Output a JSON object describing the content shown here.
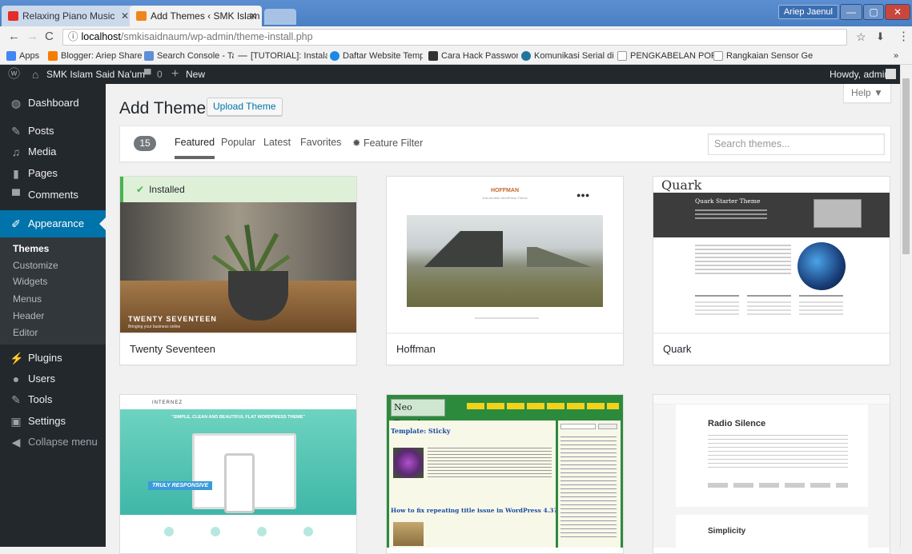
{
  "browser": {
    "tabs": [
      {
        "title": "Relaxing Piano Music",
        "favicon_color": "#e52d27"
      },
      {
        "title": "Add Themes ‹ SMK Islam",
        "favicon_color": "#f0851b"
      }
    ],
    "user_chip": "Ariep Jaenul",
    "url_host": "localhost",
    "url_path": "/smkisaidnaum/wp-admin/theme-install.php",
    "bookmarks": [
      {
        "label": "Apps",
        "icon_color": "#4285f4"
      },
      {
        "label": "Blogger: Ariep Share",
        "icon_color": "#f57d00"
      },
      {
        "label": "Search Console - Tau",
        "icon_color": "#5f8fd6"
      },
      {
        "label": "[TUTORIAL]: Instalasi",
        "icon_color": "#9e9e9e"
      },
      {
        "label": "Daftar Website Temp",
        "icon_color": "#1e88e5"
      },
      {
        "label": "Cara Hack Password",
        "icon_color": "#333333"
      },
      {
        "label": "Komunikasi Serial di",
        "icon_color": "#21759b"
      },
      {
        "label": "PENGKABELAN PORT",
        "icon_color": "#ffffff"
      },
      {
        "label": "Rangkaian Sensor Ge",
        "icon_color": "#ffffff"
      }
    ],
    "bookmarks_overflow": "»"
  },
  "adminbar": {
    "site_name": "SMK Islam Said Na'um",
    "comments_count": "0",
    "new_label": "New",
    "howdy": "Howdy, admin"
  },
  "sidebar": {
    "items": [
      {
        "label": "Dashboard",
        "icon": "dashboard-icon"
      },
      {
        "label": "Posts",
        "icon": "pin-icon"
      },
      {
        "label": "Media",
        "icon": "media-icon"
      },
      {
        "label": "Pages",
        "icon": "page-icon"
      },
      {
        "label": "Comments",
        "icon": "comment-icon"
      },
      {
        "label": "Appearance",
        "icon": "brush-icon"
      },
      {
        "label": "Plugins",
        "icon": "plugin-icon"
      },
      {
        "label": "Users",
        "icon": "user-icon"
      },
      {
        "label": "Tools",
        "icon": "wrench-icon"
      },
      {
        "label": "Settings",
        "icon": "settings-icon"
      },
      {
        "label": "Collapse menu",
        "icon": "collapse-icon"
      }
    ],
    "appearance_sub": [
      "Themes",
      "Customize",
      "Widgets",
      "Menus",
      "Header",
      "Editor"
    ]
  },
  "main": {
    "help_label": "Help ▼",
    "title": "Add Themes",
    "upload_label": "Upload Theme",
    "theme_count": "15",
    "filters": [
      "Featured",
      "Popular",
      "Latest",
      "Favorites"
    ],
    "feature_filter": "Feature Filter",
    "search_placeholder": "Search themes...",
    "installed_label": "Installed",
    "themes": [
      {
        "name": "Twenty Seventeen",
        "shot_text": "TWENTY SEVENTEEN",
        "shot_sub": "Bringing your business online"
      },
      {
        "name": "Hoffman",
        "shot_text": "HOFFMAN",
        "shot_sub": "Just Another WordPress Theme"
      },
      {
        "name": "Quark",
        "shot_text": "Quark",
        "shot_sub": "Quark Starter Theme"
      },
      {
        "name": "",
        "shot_text": "INTERNEZ",
        "shot_sub": "\"SIMPLE, CLEAN AND BEAUTIFUL FLAT WORDPRESS THEME\"",
        "shot_badge": "TRULY RESPONSIVE"
      },
      {
        "name": "",
        "shot_text": "Neo Trendy",
        "shot_sub": "Template: Sticky",
        "shot_sub2": "How to fix repeating title issue in WordPress 4.3?"
      },
      {
        "name": "",
        "shot_text": "Radio Silence",
        "shot_sub": "Simplicity"
      }
    ]
  },
  "colors": {
    "wp_dark": "#23282d",
    "wp_blue": "#0073aa",
    "installed_green": "#46b450",
    "chrome_blue": "#4a7fc3"
  }
}
